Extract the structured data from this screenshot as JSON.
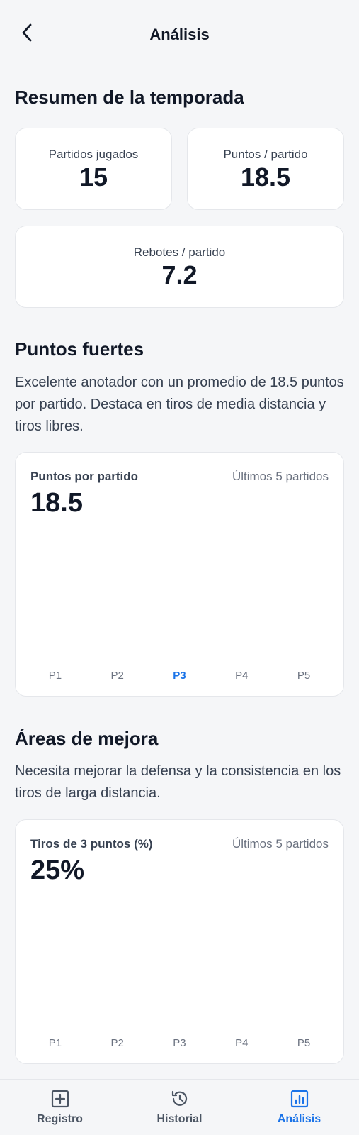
{
  "header": {
    "title": "Análisis"
  },
  "season": {
    "title": "Resumen de la temporada",
    "stats": [
      {
        "label": "Partidos jugados",
        "value": "15"
      },
      {
        "label": "Puntos / partido",
        "value": "18.5"
      },
      {
        "label": "Rebotes / partido",
        "value": "7.2"
      }
    ]
  },
  "strengths": {
    "title": "Puntos fuertes",
    "text": "Excelente anotador con un promedio de 18.5 puntos por partido. Destaca en tiros de media distancia y tiros libres.",
    "chart": {
      "label": "Puntos por partido",
      "sub": "Últimos 5 partidos",
      "value": "18.5",
      "categories": [
        "P1",
        "P2",
        "P3",
        "P4",
        "P5"
      ],
      "active": "P3"
    }
  },
  "improve": {
    "title": "Áreas de mejora",
    "text": "Necesita mejorar la defensa y la consistencia en los tiros de larga distancia.",
    "chart": {
      "label": "Tiros de 3 puntos (%)",
      "sub": "Últimos 5 partidos",
      "value": "25%",
      "categories": [
        "P1",
        "P2",
        "P3",
        "P4",
        "P5"
      ]
    }
  },
  "tabs": [
    {
      "label": "Registro",
      "icon": "plus-square-icon"
    },
    {
      "label": "Historial",
      "icon": "history-icon"
    },
    {
      "label": "Análisis",
      "icon": "chart-icon",
      "active": true
    }
  ],
  "colors": {
    "accent": "#1a73e8",
    "background": "#f5f6f8",
    "card": "#ffffff"
  }
}
